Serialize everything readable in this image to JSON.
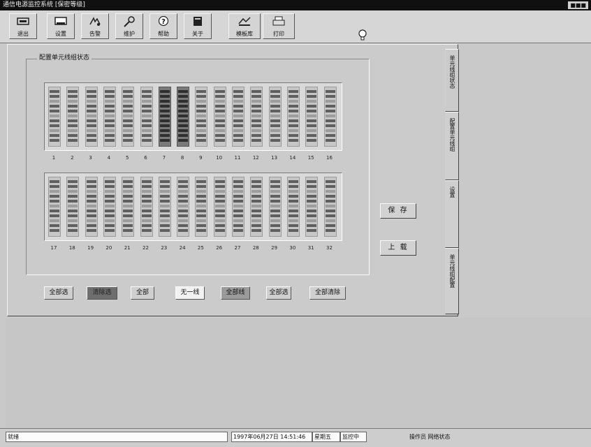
{
  "window": {
    "title": "通信电源监控系统   [保密等级]",
    "control_label": "■■■"
  },
  "toolbar": [
    {
      "label": "退出",
      "icon": "exit-icon"
    },
    {
      "label": "设置",
      "icon": "monitor-icon"
    },
    {
      "label": "告警",
      "icon": "alarm-icon"
    },
    {
      "label": "维护",
      "icon": "key-icon"
    },
    {
      "label": "帮助",
      "icon": "help-icon"
    },
    {
      "label": "关于",
      "icon": "about-icon"
    },
    {
      "label": "模板库",
      "icon": "template-icon"
    },
    {
      "label": "打印",
      "icon": "printer-icon"
    }
  ],
  "panel": {
    "group_title": "配置单元线组状态",
    "rack_top": {
      "labels": [
        "1",
        "2",
        "3",
        "4",
        "5",
        "6",
        "7",
        "8",
        "9",
        "10",
        "11",
        "12",
        "13",
        "14",
        "15",
        "16"
      ],
      "dark_slots": [
        6,
        7
      ]
    },
    "rack_bottom": {
      "labels": [
        "17",
        "18",
        "19",
        "20",
        "21",
        "22",
        "23",
        "24",
        "25",
        "26",
        "27",
        "28",
        "29",
        "30",
        "31",
        "32"
      ],
      "dark_slots": []
    },
    "buttons": [
      {
        "label": "全部选",
        "style": "normal"
      },
      {
        "label": "清除选",
        "style": "dark"
      },
      {
        "label": "全部",
        "style": "normal"
      },
      {
        "label": "无一线",
        "style": "white"
      },
      {
        "label": "全部线",
        "style": "gray"
      },
      {
        "label": "全部选",
        "style": "normal"
      },
      {
        "label": "全部清除",
        "style": "normal"
      }
    ],
    "save_label": "保 存",
    "back_label": "上 载",
    "tabs": [
      "单元线组状态",
      "配置单元线组",
      "设置",
      "单元线组配置"
    ]
  },
  "status": {
    "left_text": "就绪",
    "datetime": "1997年06月27日 14:51:46",
    "weekday": "星期五",
    "mode": "监控中",
    "right_text": "操作员 网络状态"
  },
  "colors": {
    "background": "#c9c9c9",
    "slot_dark": "#7a7a7a",
    "bar_dark": "#5f5f5f"
  }
}
